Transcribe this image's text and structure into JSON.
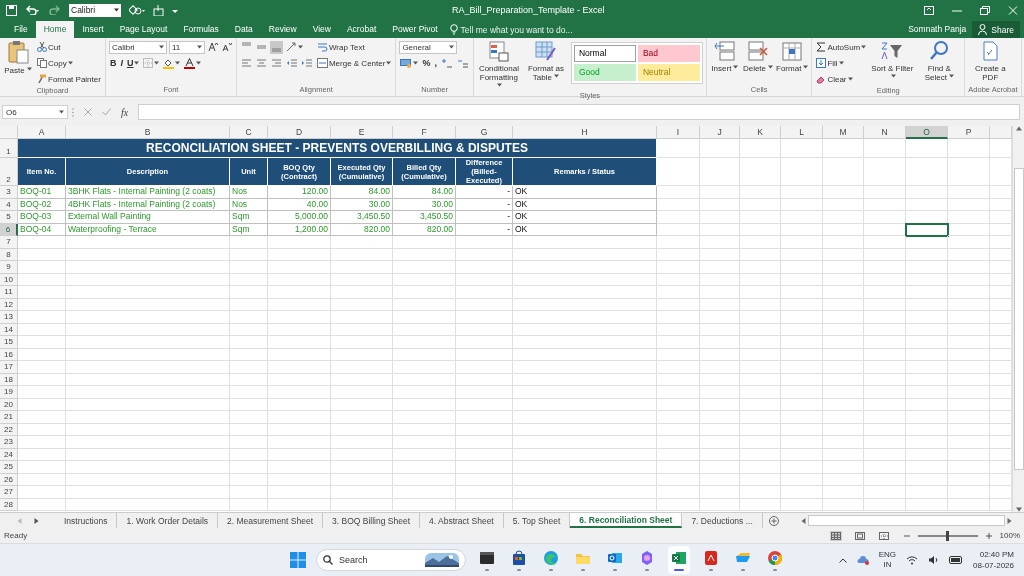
{
  "window": {
    "title": "RA_Bill_Preparation_Template - Excel",
    "user": "Somnath Panja",
    "share": "Share"
  },
  "quick_access": {
    "font": "Calibri"
  },
  "ribbon_tabs": [
    {
      "label": "File",
      "selected": false
    },
    {
      "label": "Home",
      "selected": true
    },
    {
      "label": "Insert",
      "selected": false
    },
    {
      "label": "Page Layout",
      "selected": false
    },
    {
      "label": "Formulas",
      "selected": false
    },
    {
      "label": "Data",
      "selected": false
    },
    {
      "label": "Review",
      "selected": false
    },
    {
      "label": "View",
      "selected": false
    },
    {
      "label": "Acrobat",
      "selected": false
    },
    {
      "label": "Power Pivot",
      "selected": false
    }
  ],
  "tell_me": {
    "placeholder": "Tell me what you want to do..."
  },
  "ribbon": [
    {
      "label": "Clipboard",
      "blocks": [
        {
          "kind": "paste",
          "label": "Paste",
          "menu": true
        },
        {
          "kind": "stack",
          "lines": [
            [
              {
                "kind": "cut",
                "label": "Cut"
              }
            ],
            [
              {
                "kind": "copy",
                "label": "Copy",
                "menu": true
              }
            ],
            [
              {
                "kind": "painter",
                "label": "Format Painter"
              }
            ]
          ]
        }
      ]
    },
    {
      "label": "Font",
      "blocks": [
        {
          "kind": "stack",
          "lines": [
            [
              {
                "kind": "combo",
                "value": "Calibri"
              },
              {
                "kind": "combo",
                "value": "11"
              },
              {
                "kind": "grow"
              },
              {
                "kind": "shrink"
              }
            ],
            [
              {
                "kind": "bold",
                "text": "B"
              },
              {
                "kind": "italic",
                "text": "I"
              },
              {
                "kind": "underline",
                "text": "U",
                "menu": true
              },
              {
                "kind": "borders",
                "menu": true
              },
              {
                "kind": "fill",
                "menu": true
              },
              {
                "kind": "fontcolor",
                "menu": true
              }
            ]
          ]
        }
      ]
    },
    {
      "label": "Alignment",
      "blocks": [
        {
          "kind": "stack",
          "lines": [
            [
              {
                "kind": "aligntop",
                "selected": false
              },
              {
                "kind": "alignmid",
                "selected": false
              },
              {
                "kind": "alignbot",
                "selected": true
              },
              {
                "kind": "orient",
                "menu": true
              }
            ],
            [
              {
                "kind": "alignleft"
              },
              {
                "kind": "aligncenter"
              },
              {
                "kind": "alignright"
              },
              {
                "kind": "outdent"
              },
              {
                "kind": "indent"
              }
            ]
          ]
        },
        {
          "kind": "stack",
          "lines": [
            [
              {
                "kind": "wrap",
                "label": "Wrap Text"
              }
            ],
            [
              {
                "kind": "merge",
                "label": "Merge & Center",
                "menu": true
              }
            ]
          ]
        }
      ]
    },
    {
      "label": "Number",
      "blocks": [
        {
          "kind": "stack",
          "lines": [
            [
              {
                "kind": "combo",
                "value": "General"
              }
            ],
            [
              {
                "kind": "currency",
                "menu": true
              },
              {
                "kind": "percent",
                "text": "%"
              },
              {
                "kind": "comma",
                "text": ","
              },
              {
                "kind": "incdec"
              },
              {
                "kind": "decdec"
              }
            ]
          ]
        }
      ]
    },
    {
      "label": "Styles",
      "blocks": [
        {
          "kind": "condformat",
          "label": "Conditional Formatting",
          "menu": true
        },
        {
          "kind": "formattable",
          "label": "Format as Table",
          "menu": true
        },
        {
          "kind": "gallery",
          "styles": [
            {
              "label": "Normal",
              "color": "#ffffff"
            },
            {
              "label": "Bad",
              "color": "#ffc7ce"
            },
            {
              "label": "Good",
              "color": "#c6efce"
            },
            {
              "label": "Neutral",
              "color": "#ffeb9c"
            }
          ]
        }
      ]
    },
    {
      "label": "Cells",
      "blocks": [
        {
          "kind": "insert",
          "label": "Insert",
          "menu": true
        },
        {
          "kind": "delete",
          "label": "Delete",
          "menu": true
        },
        {
          "kind": "format",
          "label": "Format",
          "menu": true
        }
      ]
    },
    {
      "label": "Editing",
      "blocks": [
        {
          "kind": "stack",
          "lines": [
            [
              {
                "kind": "autosum",
                "label": "AutoSum",
                "menu": true
              }
            ],
            [
              {
                "kind": "fillbtn",
                "label": "Fill",
                "menu": true
              }
            ],
            [
              {
                "kind": "clear",
                "label": "Clear",
                "menu": true
              }
            ]
          ]
        },
        {
          "kind": "sort",
          "label": "Sort & Filter",
          "menu": true
        },
        {
          "kind": "find",
          "label": "Find & Select",
          "menu": true
        }
      ]
    },
    {
      "label": "Adobe Acrobat",
      "blocks": [
        {
          "kind": "pdf",
          "label": "Create a PDF"
        }
      ]
    }
  ],
  "formula_bar": {
    "name_box": "O6",
    "function_label": "fx"
  },
  "sheet": {
    "columns": [
      {
        "label": "A",
        "selected": false
      },
      {
        "label": "B",
        "selected": false
      },
      {
        "label": "C",
        "selected": false
      },
      {
        "label": "D",
        "selected": false
      },
      {
        "label": "E",
        "selected": false
      },
      {
        "label": "F",
        "selected": false
      },
      {
        "label": "G",
        "selected": false
      },
      {
        "label": "H",
        "selected": false
      },
      {
        "label": "I",
        "selected": false
      },
      {
        "label": "J",
        "selected": false
      },
      {
        "label": "K",
        "selected": false
      },
      {
        "label": "L",
        "selected": false
      },
      {
        "label": "M",
        "selected": false
      },
      {
        "label": "N",
        "selected": false
      },
      {
        "label": "O",
        "selected": true
      },
      {
        "label": "P",
        "selected": false
      }
    ],
    "rows": [
      {
        "label": "1",
        "selected": false
      },
      {
        "label": "2",
        "selected": false
      },
      {
        "label": "3",
        "selected": false
      },
      {
        "label": "4",
        "selected": false
      },
      {
        "label": "5",
        "selected": false
      },
      {
        "label": "6",
        "selected": true
      },
      {
        "label": "7",
        "selected": false
      },
      {
        "label": "8",
        "selected": false
      },
      {
        "label": "9",
        "selected": false
      },
      {
        "label": "10",
        "selected": false
      },
      {
        "label": "11",
        "selected": false
      },
      {
        "label": "12",
        "selected": false
      },
      {
        "label": "13",
        "selected": false
      },
      {
        "label": "14",
        "selected": false
      },
      {
        "label": "15",
        "selected": false
      },
      {
        "label": "16",
        "selected": false
      },
      {
        "label": "17",
        "selected": false
      },
      {
        "label": "18",
        "selected": false
      },
      {
        "label": "19",
        "selected": false
      },
      {
        "label": "20",
        "selected": false
      },
      {
        "label": "21",
        "selected": false
      },
      {
        "label": "22",
        "selected": false
      },
      {
        "label": "23",
        "selected": false
      },
      {
        "label": "24",
        "selected": false
      },
      {
        "label": "25",
        "selected": false
      },
      {
        "label": "26",
        "selected": false
      },
      {
        "label": "27",
        "selected": false
      },
      {
        "label": "28",
        "selected": false
      }
    ],
    "title": "RECONCILIATION SHEET - PREVENTS OVERBILLING & DISPUTES",
    "headers": [
      "Item No.",
      "Description",
      "Unit",
      "BOQ Qty (Contract)",
      "Executed Qty (Cumulative)",
      "Billed Qty (Cumulative)",
      "Difference (Billed-Executed)",
      "Remarks / Status"
    ],
    "data": [
      [
        "BOQ-01",
        "3BHK Flats - Internal Painting (2 coats)",
        "Nos",
        "120.00",
        "84.00",
        "84.00",
        "-",
        "OK"
      ],
      [
        "BOQ-02",
        "4BHK Flats - Internal Painting (2 coats)",
        "Nos",
        "40.00",
        "30.00",
        "30.00",
        "-",
        "OK"
      ],
      [
        "BOQ-03",
        "External Wall Painting",
        "Sqm",
        "5,000.00",
        "3,450.50",
        "3,450.50",
        "-",
        "OK"
      ],
      [
        "BOQ-04",
        "Waterproofing - Terrace",
        "Sqm",
        "1,200.00",
        "820.00",
        "820.00",
        "-",
        "OK"
      ]
    ]
  },
  "sheet_tabs": [
    {
      "label": "Instructions",
      "selected": false
    },
    {
      "label": "1. Work Order Details",
      "selected": false
    },
    {
      "label": "2. Measurement Sheet",
      "selected": false
    },
    {
      "label": "3. BOQ Billing Sheet",
      "selected": false
    },
    {
      "label": "4. Abstract Sheet",
      "selected": false
    },
    {
      "label": "5. Top Sheet",
      "selected": false
    },
    {
      "label": "6. Reconciliation Sheet",
      "selected": true
    },
    {
      "label": "7. Deductions ...",
      "selected": false
    }
  ],
  "status_bar": {
    "status": "Ready",
    "views": [
      {
        "kind": "normal",
        "selected": true
      },
      {
        "kind": "layout",
        "selected": false
      },
      {
        "kind": "pagebreak",
        "selected": false
      }
    ],
    "zoom": {
      "level": 0.5
    },
    "zoom_label": "100%"
  },
  "taskbar": {
    "search": {
      "placeholder": "Search"
    },
    "apps": [
      {
        "kind": "terminal",
        "active": false
      },
      {
        "kind": "store",
        "active": false
      },
      {
        "kind": "edge",
        "active": false
      },
      {
        "kind": "folder",
        "active": false
      },
      {
        "kind": "outlook",
        "active": false
      },
      {
        "kind": "copilot",
        "active": false
      },
      {
        "kind": "excel",
        "active": true
      },
      {
        "kind": "acrobat",
        "active": false
      },
      {
        "kind": "app",
        "active": false
      },
      {
        "kind": "chrome",
        "active": false
      }
    ],
    "language": "ENG",
    "region": "IN",
    "time": "02:40 PM",
    "date": "08-07-2026"
  }
}
